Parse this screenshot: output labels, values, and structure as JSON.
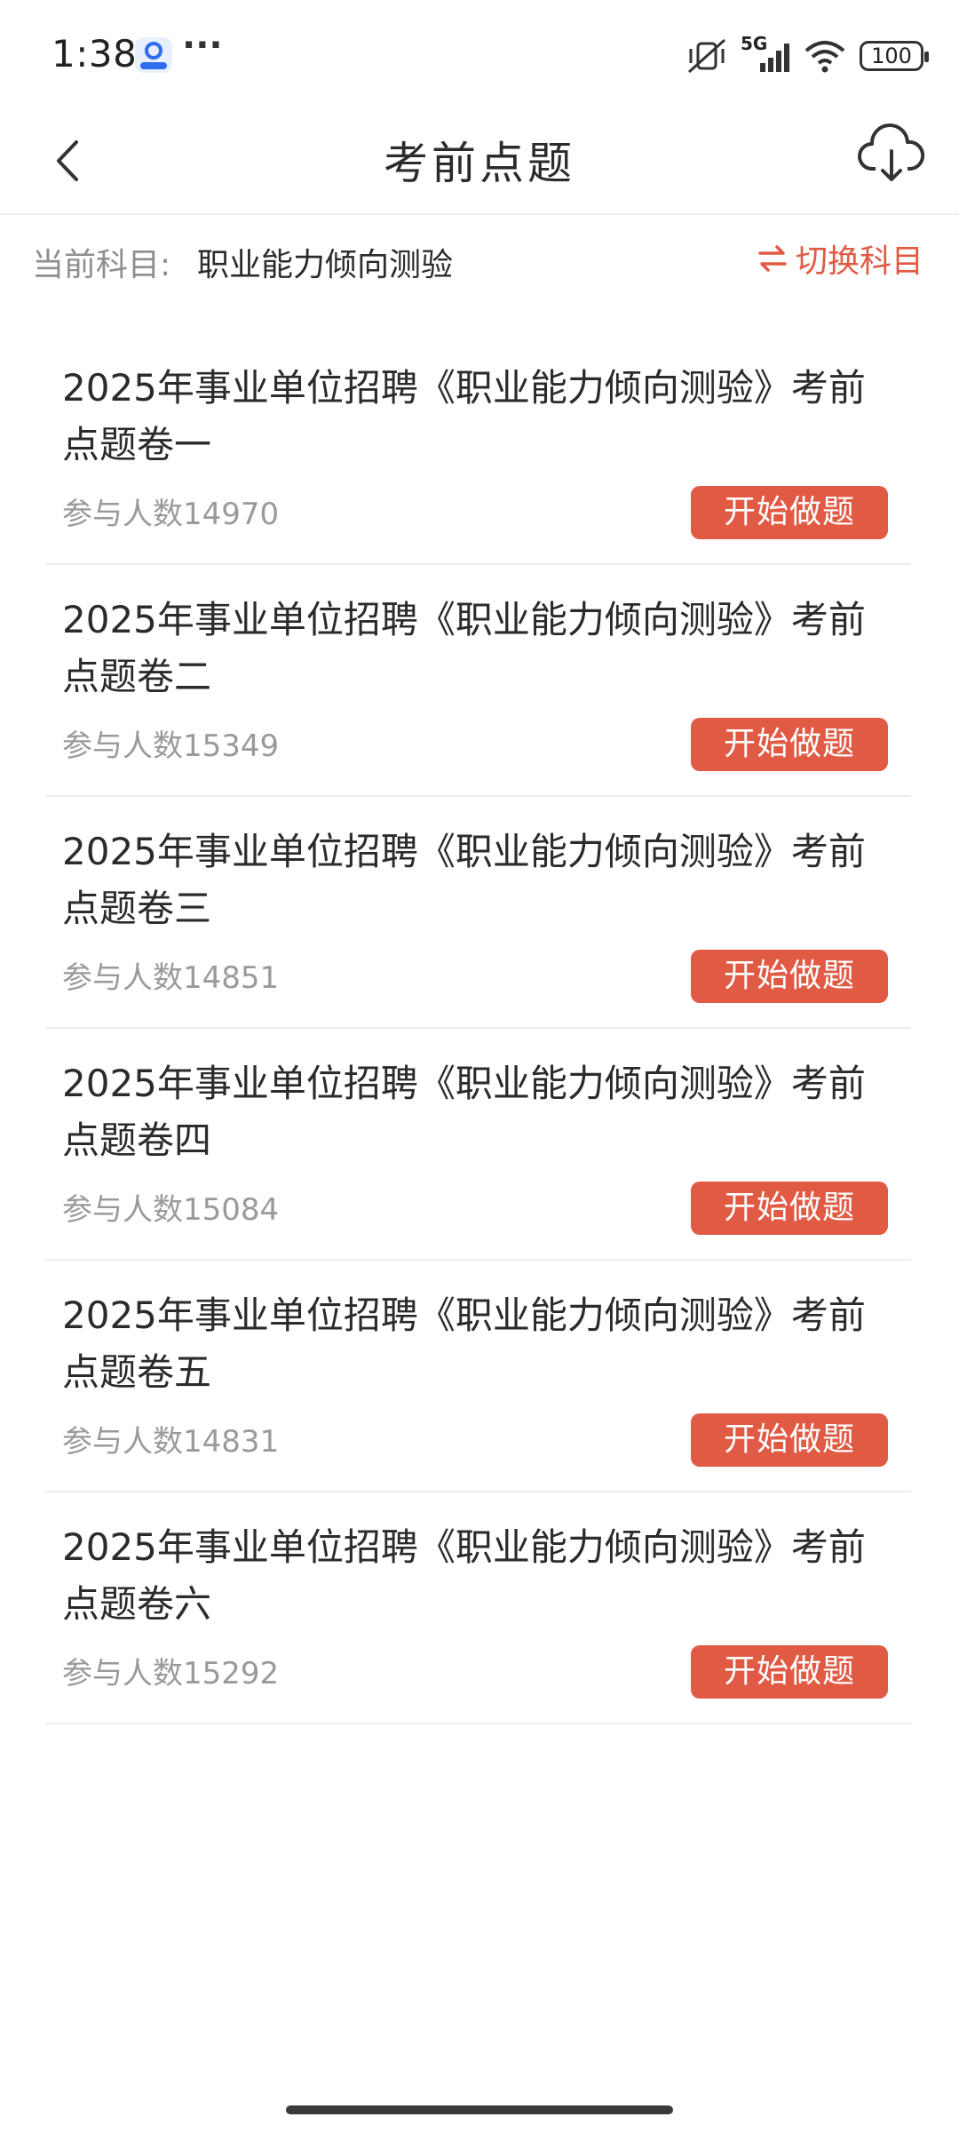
{
  "status": {
    "time": "1:38",
    "more": "···",
    "network": "5G",
    "battery": "100"
  },
  "nav": {
    "title": "考前点题"
  },
  "subject": {
    "label": "当前科目:",
    "value": "职业能力倾向测验",
    "switch_label": "切换科目"
  },
  "items": [
    {
      "title": "2025年事业单位招聘《职业能力倾向测验》考前点题卷一",
      "count": "参与人数14970",
      "button": "开始做题"
    },
    {
      "title": "2025年事业单位招聘《职业能力倾向测验》考前点题卷二",
      "count": "参与人数15349",
      "button": "开始做题"
    },
    {
      "title": "2025年事业单位招聘《职业能力倾向测验》考前点题卷三",
      "count": "参与人数14851",
      "button": "开始做题"
    },
    {
      "title": "2025年事业单位招聘《职业能力倾向测验》考前点题卷四",
      "count": "参与人数15084",
      "button": "开始做题"
    },
    {
      "title": "2025年事业单位招聘《职业能力倾向测验》考前点题卷五",
      "count": "参与人数14831",
      "button": "开始做题"
    },
    {
      "title": "2025年事业单位招聘《职业能力倾向测验》考前点题卷六",
      "count": "参与人数15292",
      "button": "开始做题"
    }
  ],
  "colors": {
    "accent": "#e05a44"
  }
}
